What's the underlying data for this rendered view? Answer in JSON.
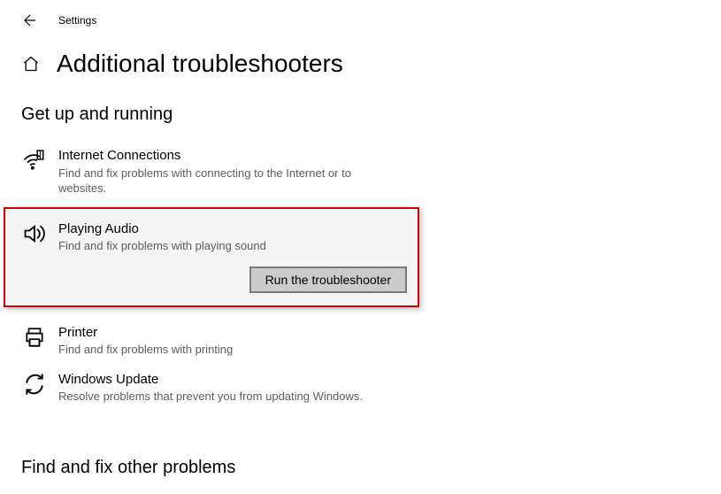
{
  "window": {
    "title": "Settings"
  },
  "page": {
    "title": "Additional troubleshooters"
  },
  "sections": {
    "getup": {
      "heading": "Get up and running"
    },
    "other": {
      "heading": "Find and fix other problems"
    }
  },
  "troubleshooters": {
    "internet": {
      "name": "Internet Connections",
      "desc": "Find and fix problems with connecting to the Internet or to websites."
    },
    "audio": {
      "name": "Playing Audio",
      "desc": "Find and fix problems with playing sound",
      "button": "Run the troubleshooter"
    },
    "printer": {
      "name": "Printer",
      "desc": "Find and fix problems with printing"
    },
    "update": {
      "name": "Windows Update",
      "desc": "Resolve problems that prevent you from updating Windows."
    }
  }
}
